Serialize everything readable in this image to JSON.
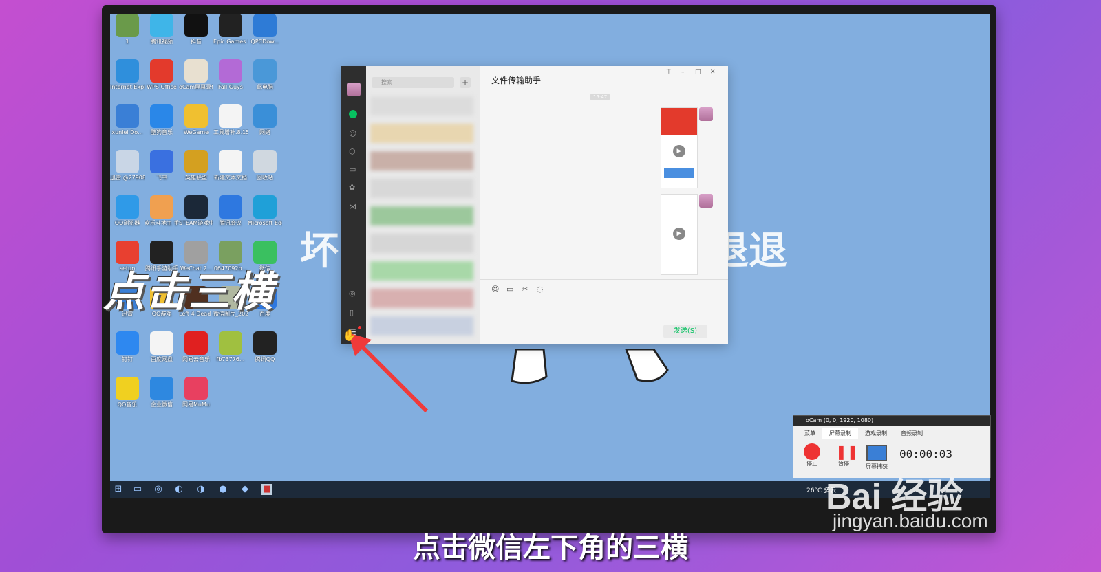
{
  "overlay": {
    "title": "点击三横"
  },
  "subtitle": "点击微信左下角的三横",
  "background_text": {
    "left": "坏",
    "right": "退退"
  },
  "desktop_icons": [
    {
      "label": "1",
      "color": "#6a9a4a"
    },
    {
      "label": "腾讯视频",
      "color": "#3fb5e8"
    },
    {
      "label": "抖音",
      "color": "#111111"
    },
    {
      "label": "Epic Games Launcher",
      "color": "#222222"
    },
    {
      "label": "QPCDow...",
      "color": "#2e7bd6"
    },
    {
      "label": "Internet Explorer",
      "color": "#2f8fdc"
    },
    {
      "label": "WPS Office",
      "color": "#e33a2c"
    },
    {
      "label": "oCam屏幕录像",
      "color": "#e8e0d0"
    },
    {
      "label": "Fall Guys",
      "color": "#b36ad6"
    },
    {
      "label": "此电脑",
      "color": "#4a98d8"
    },
    {
      "label": "xunlei Do...",
      "color": "#3a7fd6"
    },
    {
      "label": "酷狗音乐",
      "color": "#2a87e8"
    },
    {
      "label": "WeGame",
      "color": "#f0c030"
    },
    {
      "label": "工具增补.8.15",
      "color": "#f4f4f4"
    },
    {
      "label": "网络",
      "color": "#3a8fd8"
    },
    {
      "label": "迅雷 @279084...",
      "color": "#c9d6e6"
    },
    {
      "label": "飞书",
      "color": "#3a70e0"
    },
    {
      "label": "英雄联盟",
      "color": "#d4a020"
    },
    {
      "label": "新建文本文档",
      "color": "#f4f4f4"
    },
    {
      "label": "回收站",
      "color": "#d0d8e0"
    },
    {
      "label": "QQ浏览器",
      "color": "#2f9ae8"
    },
    {
      "label": "欢乐斗地主 手游电脑版",
      "color": "#f0a050"
    },
    {
      "label": "STEAM游戏中心",
      "color": "#1b2838"
    },
    {
      "label": "腾讯会议",
      "color": "#2e78e0"
    },
    {
      "label": "Microsoft Edge",
      "color": "#1fa0d8"
    },
    {
      "label": "setup",
      "color": "#e84030"
    },
    {
      "label": "腾讯手游助手",
      "color": "#222222"
    },
    {
      "label": "WeChat 2...",
      "color": "#a0a0a0"
    },
    {
      "label": "0647092b...",
      "color": "#7aa060"
    },
    {
      "label": "微信",
      "color": "#3ac060"
    },
    {
      "label": "迅雷",
      "color": "#3a7fd6"
    },
    {
      "label": "QQ游戏",
      "color": "#f0c030"
    },
    {
      "label": "Left 4 Dead 2",
      "color": "#503020"
    },
    {
      "label": "微信图片_2022030...",
      "color": "#b0b8a0"
    },
    {
      "label": "百度",
      "color": "#2e78e0"
    },
    {
      "label": "钉钉",
      "color": "#2e88f0"
    },
    {
      "label": "百度网盘",
      "color": "#f4f4f4"
    },
    {
      "label": "网易云音乐",
      "color": "#e02020"
    },
    {
      "label": "fb73776...",
      "color": "#a0c040"
    },
    {
      "label": "腾讯QQ",
      "color": "#222222"
    },
    {
      "label": "QQ音乐",
      "color": "#f0d020"
    },
    {
      "label": "企业微信",
      "color": "#2e88e0"
    },
    {
      "label": "网易MuMu",
      "color": "#e84060"
    }
  ],
  "wechat": {
    "search_placeholder": "搜索",
    "plus": "+",
    "chat_title": "文件传输助手",
    "time": "15:47",
    "send_label": "发送(S)",
    "win_pin": "⊤",
    "win_min": "–",
    "win_max": "□",
    "win_close": "✕"
  },
  "ocam": {
    "title": "oCam (0, 0, 1920, 1080)",
    "tabs": [
      "菜单",
      "屏幕录制",
      "游戏录制",
      "音频录制"
    ],
    "stop": "停止",
    "pause": "暂停",
    "capture": "屏幕捕获",
    "timer": "00:00:03"
  },
  "taskbar": {
    "weather": "26°C 多云"
  },
  "watermark": {
    "logo": "Bai 经验",
    "url": "jingyan.baidu.com"
  }
}
